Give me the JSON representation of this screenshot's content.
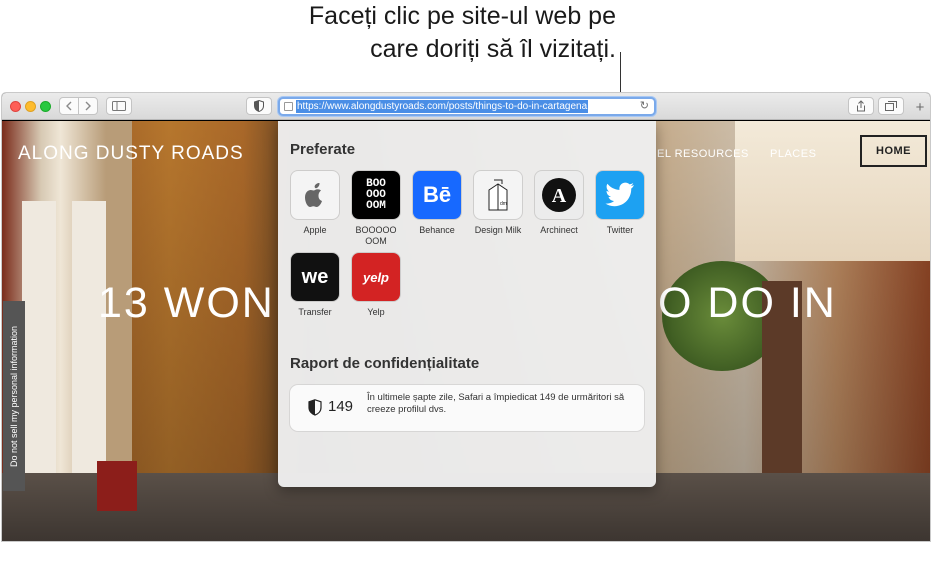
{
  "callout": {
    "line1": "Faceți clic pe site-ul web pe",
    "line2": "care doriți să îl vizitați."
  },
  "toolbar": {
    "back_icon": "chevron-left-icon",
    "forward_icon": "chevron-right-icon",
    "sidebar_icon": "sidebar-icon",
    "shield_icon": "shield-icon",
    "share_icon": "share-icon",
    "tabs_icon": "tabs-overview-icon",
    "new_tab_label": "+"
  },
  "address_bar": {
    "url": "https://www.alongdustyroads.com/posts/things-to-do-in-cartagena",
    "reload_icon": "reload-icon"
  },
  "page": {
    "site_title": "ALONG DUSTY ROADS",
    "nav_resources": "EL RESOURCES",
    "nav_places": "PLACES",
    "nav_home": "HOME",
    "hero_left": "13 WON",
    "hero_right": "O DO IN",
    "side_tab": "Do not sell my personal information"
  },
  "favorites": {
    "title": "Preferate",
    "items": [
      {
        "label": "Apple",
        "icon": "apple-logo-icon"
      },
      {
        "label": "BOOOOO OOM",
        "tile_lines": [
          "BOO",
          "OOO",
          "OOM"
        ]
      },
      {
        "label": "Behance",
        "tile_text": "Bē"
      },
      {
        "label": "Design Milk",
        "icon": "milk-carton-icon",
        "tile_text": "dm"
      },
      {
        "label": "Archinect",
        "tile_text": "A"
      },
      {
        "label": "Twitter",
        "icon": "twitter-bird-icon"
      },
      {
        "label": "Transfer",
        "tile_text": "we"
      },
      {
        "label": "Yelp",
        "tile_text": "yelp"
      }
    ]
  },
  "privacy": {
    "title": "Raport de confidențialitate",
    "count": "149",
    "text": "În ultimele șapte zile, Safari a împiedicat 149 de urmăritori să creeze profilul dvs."
  }
}
